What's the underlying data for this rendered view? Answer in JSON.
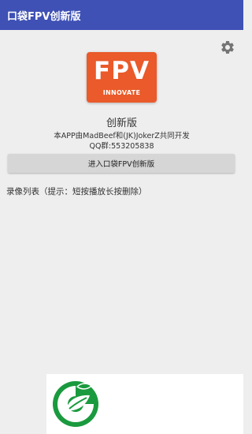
{
  "appbar": {
    "title": "口袋FPV创新版"
  },
  "icons": {
    "settings": "gear-icon",
    "ad_logo": "leaf-logo-icon"
  },
  "logo": {
    "main_text": "FPV",
    "sub_text": "INNOVATE"
  },
  "info": {
    "app_name": "创新版",
    "authors": "本APP由MadBeef和(JK)JokerZ共同开发",
    "qq_group": "QQ群:553205838"
  },
  "actions": {
    "enter_button": "进入口袋FPV创新版"
  },
  "recordings": {
    "title": "录像列表（提示：短按播放长按删除）"
  },
  "colors": {
    "appbar": "#3f51b5",
    "logo_bg": "#ea5a2a",
    "background": "#eeeeee",
    "button_bg": "#d6d6d6",
    "ad_logo_green": "#1a9a3e"
  }
}
